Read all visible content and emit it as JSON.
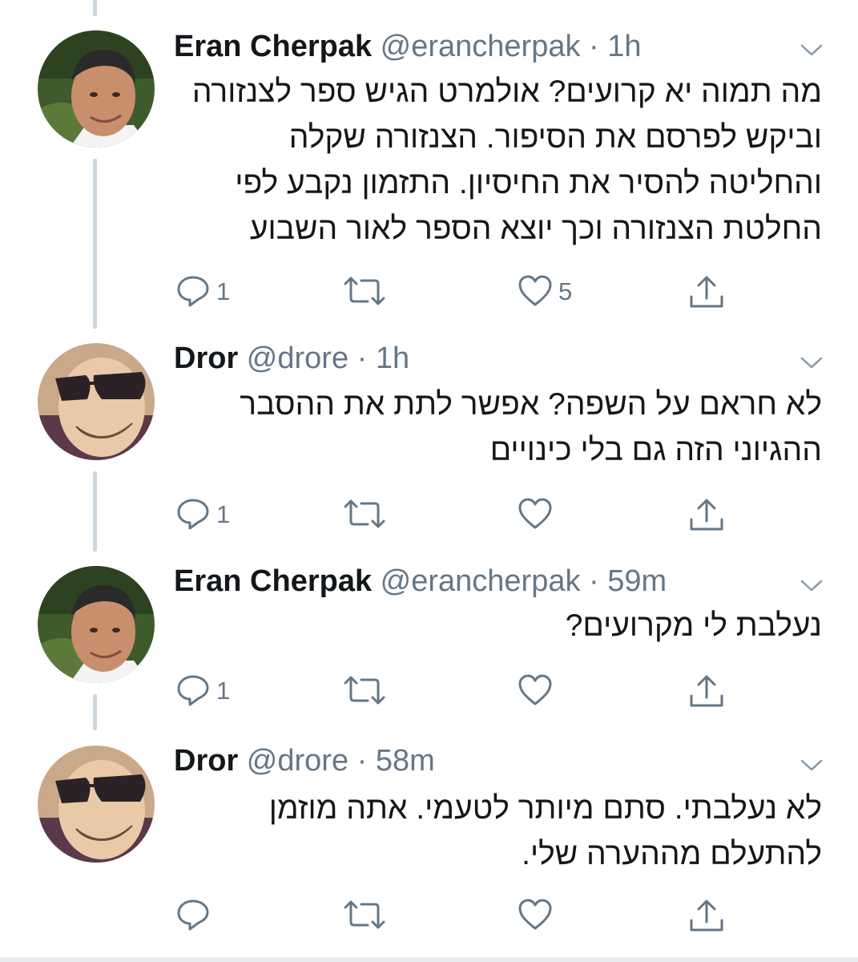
{
  "tweets": [
    {
      "name": "Eran Cherpak",
      "handle": "@erancherpak",
      "dot": "·",
      "time": "1h",
      "text_lines": [
        "מה תמוה יא קרועים? אולמרט הגיש ספר לצנזורה",
        "וביקש לפרסם את הסיפור. הצנזורה שקלה",
        "והחליטה להסיר את החיסיון. התזמון נקבע לפי",
        "החלטת הצנזורה וכך יוצא הספר לאור השבוע"
      ],
      "reply_count": "1",
      "like_count": "5"
    },
    {
      "name": "Dror",
      "handle": "@drore",
      "dot": "·",
      "time": "1h",
      "text_lines": [
        "לא חראם על השפה? אפשר לתת את ההסבר",
        "ההגיוני הזה גם בלי כינויים"
      ],
      "reply_count": "1",
      "like_count": ""
    },
    {
      "name": "Eran Cherpak",
      "handle": "@erancherpak",
      "dot": "·",
      "time": "59m",
      "text_lines": [
        "נעלבת לי מקרועים?"
      ],
      "reply_count": "1",
      "like_count": ""
    },
    {
      "name": "Dror",
      "handle": "@drore",
      "dot": "·",
      "time": "58m",
      "text_lines": [
        "לא נעלבתי. סתם מיותר לטעמי. אתה מוזמן",
        "להתעלם מההערה שלי."
      ],
      "reply_count": "",
      "like_count": ""
    }
  ],
  "icons": {
    "reply": "reply-icon",
    "retweet": "retweet-icon",
    "like": "like-icon",
    "share": "share-icon",
    "more": "chevron-down-icon"
  },
  "colors": {
    "icon": "#657786",
    "thread_line": "#ccd6dd",
    "text": "#14171a"
  }
}
